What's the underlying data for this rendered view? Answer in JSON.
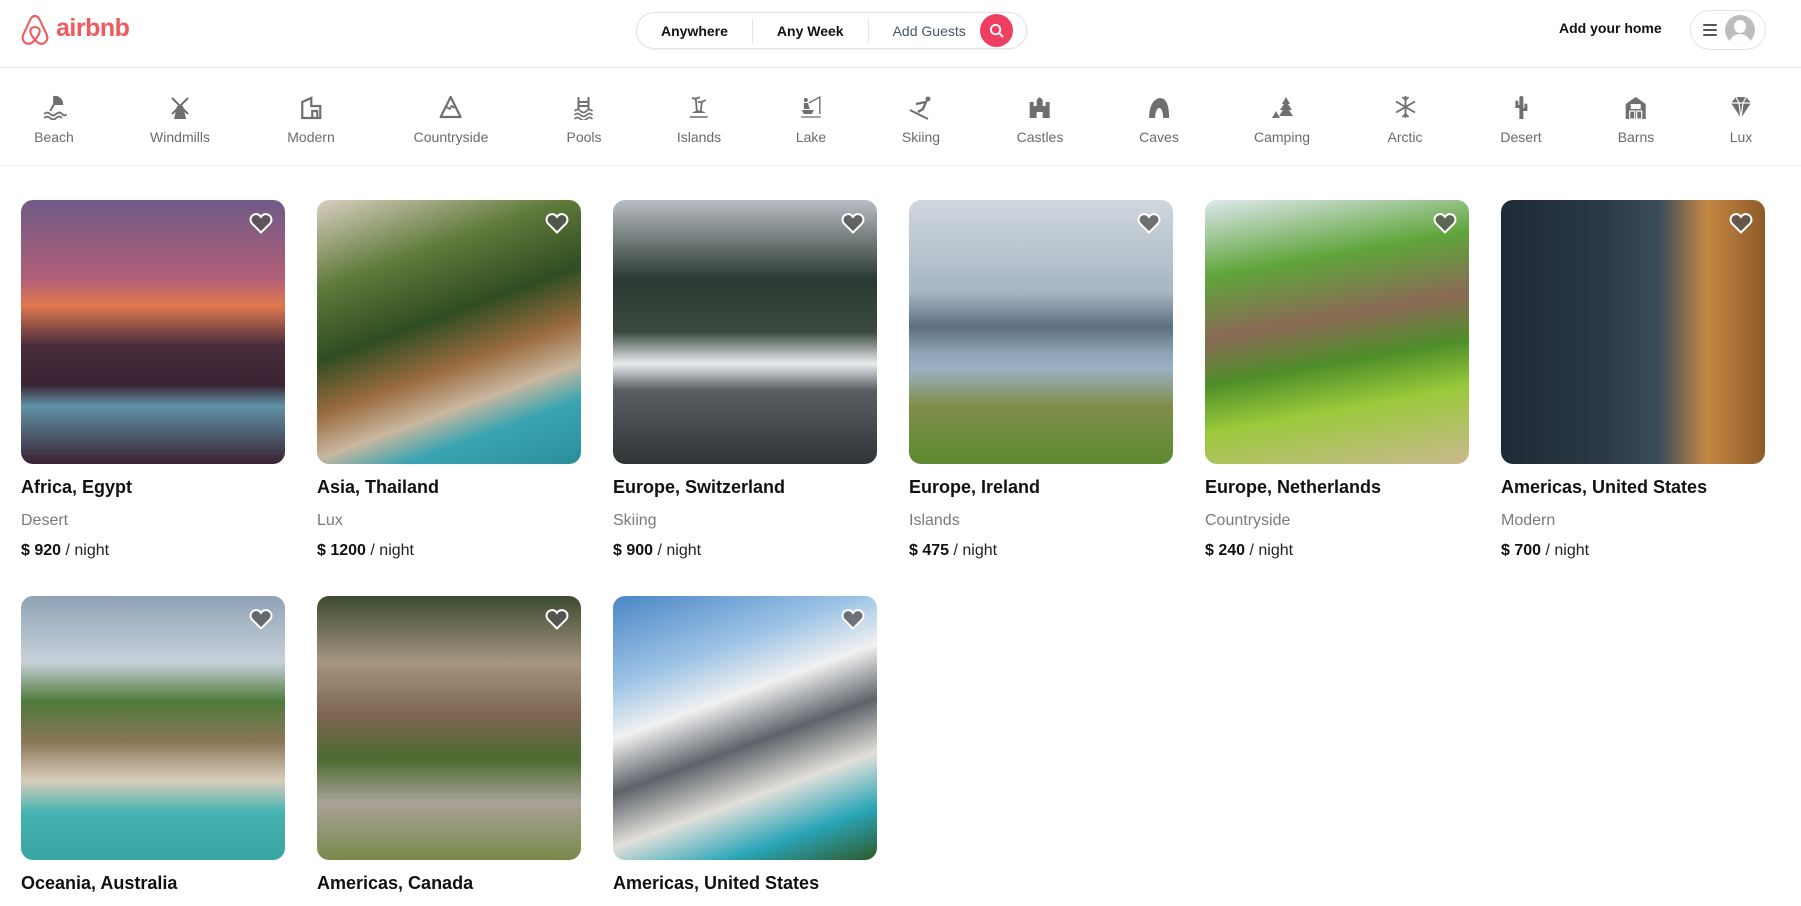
{
  "header": {
    "logo_text": "airbnb",
    "brand_color": "#f05a5e",
    "search": {
      "location": "Anywhere",
      "dates": "Any Week",
      "guests": "Add Guests",
      "button_color": "#ee3f63"
    },
    "add_home_label": "Add your home"
  },
  "categories": [
    {
      "label": "Beach",
      "icon": "beach-umbrella-icon"
    },
    {
      "label": "Windmills",
      "icon": "windmill-icon"
    },
    {
      "label": "Modern",
      "icon": "modern-house-icon"
    },
    {
      "label": "Countryside",
      "icon": "mountain-icon"
    },
    {
      "label": "Pools",
      "icon": "pool-ladder-icon"
    },
    {
      "label": "Islands",
      "icon": "island-palm-icon"
    },
    {
      "label": "Lake",
      "icon": "fishing-icon"
    },
    {
      "label": "Skiing",
      "icon": "skier-icon"
    },
    {
      "label": "Castles",
      "icon": "castle-icon"
    },
    {
      "label": "Caves",
      "icon": "cave-icon"
    },
    {
      "label": "Camping",
      "icon": "tent-tree-icon"
    },
    {
      "label": "Arctic",
      "icon": "snowflake-icon"
    },
    {
      "label": "Desert",
      "icon": "cactus-icon"
    },
    {
      "label": "Barns",
      "icon": "barn-icon"
    },
    {
      "label": "Lux",
      "icon": "diamond-icon"
    }
  ],
  "listings": [
    {
      "location": "Africa, Egypt",
      "category": "Desert",
      "currency": "$",
      "price": "920",
      "unit": "/ night",
      "favorited": false
    },
    {
      "location": "Asia, Thailand",
      "category": "Lux",
      "currency": "$",
      "price": "1200",
      "unit": "/ night",
      "favorited": false
    },
    {
      "location": "Europe, Switzerland",
      "category": "Skiing",
      "currency": "$",
      "price": "900",
      "unit": "/ night",
      "favorited": false
    },
    {
      "location": "Europe, Ireland",
      "category": "Islands",
      "currency": "$",
      "price": "475",
      "unit": "/ night",
      "favorited": false
    },
    {
      "location": "Europe, Netherlands",
      "category": "Countryside",
      "currency": "$",
      "price": "240",
      "unit": "/ night",
      "favorited": false
    },
    {
      "location": "Americas, United States",
      "category": "Modern",
      "currency": "$",
      "price": "700",
      "unit": "/ night",
      "favorited": false
    },
    {
      "location": "Oceania, Australia"
    },
    {
      "location": "Americas, Canada"
    },
    {
      "location": "Americas, United States"
    }
  ]
}
